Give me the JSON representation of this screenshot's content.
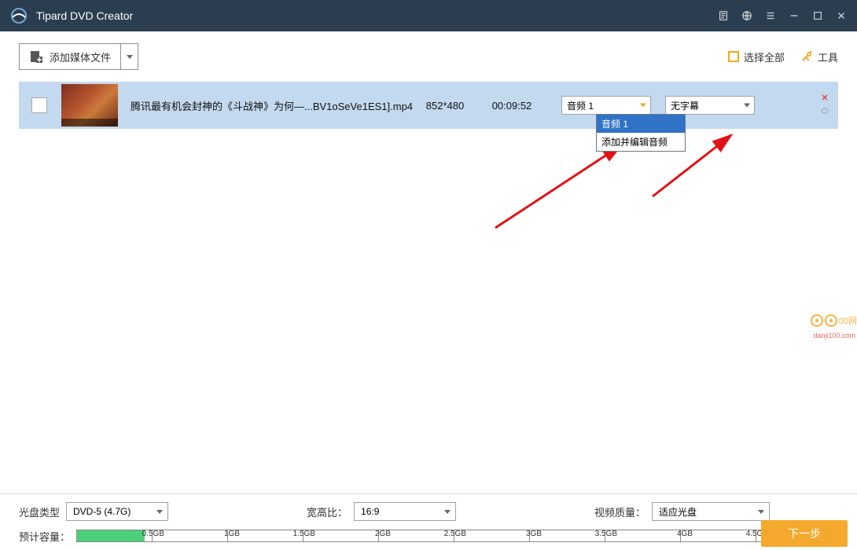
{
  "titlebar": {
    "title": "Tipard DVD Creator"
  },
  "toolbar": {
    "add_media_label": "添加媒体文件",
    "select_all_label": "选择全部",
    "tools_label": "工具"
  },
  "media": {
    "filename": "腾讯最有机会封神的《斗战神》为何—...BV1oSeVe1ES1].mp4",
    "resolution": "852*480",
    "duration": "00:09:52",
    "audio_selected": "音频 1",
    "subtitle_selected": "无字幕",
    "audio_options": [
      "音频 1",
      "添加并编辑音频"
    ]
  },
  "bottom": {
    "disc_type_label": "光盘类型",
    "disc_type_value": "DVD-5 (4.7G)",
    "aspect_label": "宽高比：",
    "aspect_value": "16:9",
    "quality_label": "视频质量：",
    "quality_value": "适应光盘",
    "capacity_label": "预计容量：",
    "ticks": [
      "0.5GB",
      "1GB",
      "1.5GB",
      "2GB",
      "2.5GB",
      "3GB",
      "3.5GB",
      "4GB",
      "4.5GB"
    ],
    "next_label": "下一步"
  },
  "watermark": {
    "text": "00网",
    "sub": "danji100.com"
  }
}
